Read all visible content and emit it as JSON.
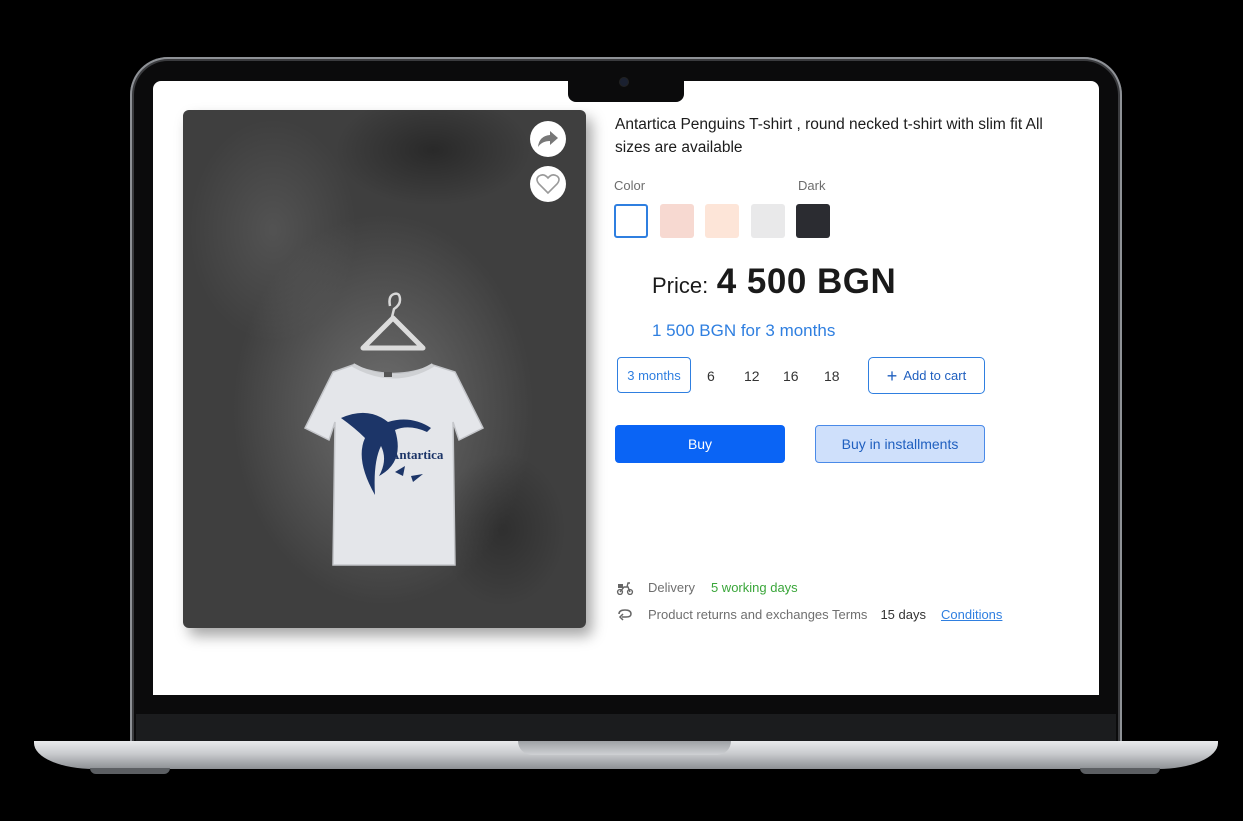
{
  "product": {
    "title": "Antartica Penguins T-shirt , round necked t-shirt with slim fit All sizes are available",
    "shirt_print": "Antartica"
  },
  "colors": {
    "label": "Color",
    "selected_name": "Dark",
    "swatches": [
      "#ffffff",
      "#f7d9d1",
      "#fde5d8",
      "#e9e9ea",
      "#2b2c31"
    ],
    "selected_index": 0
  },
  "price": {
    "label": "Price:",
    "value": "4 500 BGN",
    "installment_text": "1 500 BGN for 3 months"
  },
  "installments": {
    "selected": "3 months",
    "options": [
      "6",
      "12",
      "16",
      "18"
    ]
  },
  "actions": {
    "add_to_cart": "Add to cart",
    "buy": "Buy",
    "buy_installments": "Buy in installments"
  },
  "delivery": {
    "label": "Delivery",
    "value": "5 working days",
    "icon": "scooter-icon"
  },
  "returns": {
    "label": "Product returns and exchanges Terms",
    "value": "15 days",
    "link": "Conditions",
    "icon": "return-arrow-icon"
  },
  "theme": {
    "accent": "#0a64f5",
    "link": "#2f7fe0",
    "success": "#3aa63a"
  }
}
